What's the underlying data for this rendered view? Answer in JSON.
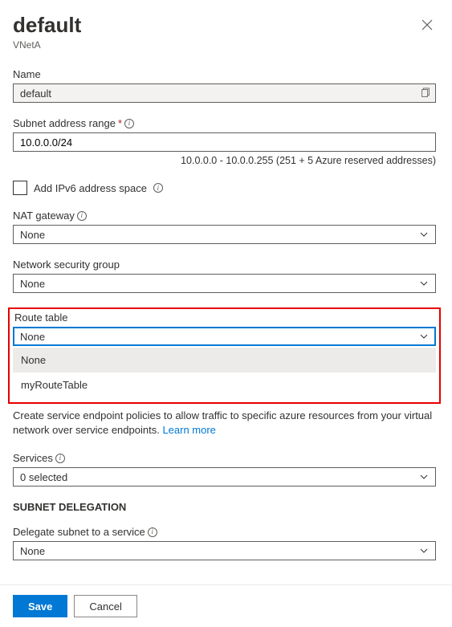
{
  "header": {
    "title": "default",
    "subtitle": "VNetA"
  },
  "name": {
    "label": "Name",
    "value": "default"
  },
  "addressRange": {
    "label": "Subnet address range",
    "value": "10.0.0.0/24",
    "help": "10.0.0.0 - 10.0.0.255 (251 + 5 Azure reserved addresses)"
  },
  "ipv6": {
    "label": "Add IPv6 address space"
  },
  "natGateway": {
    "label": "NAT gateway",
    "value": "None"
  },
  "nsg": {
    "label": "Network security group",
    "value": "None"
  },
  "routeTable": {
    "label": "Route table",
    "value": "None",
    "options": [
      "None",
      "myRouteTable"
    ]
  },
  "endpointDescription": "Create service endpoint policies to allow traffic to specific azure resources from your virtual network over service endpoints. ",
  "learnMore": "Learn more",
  "services": {
    "label": "Services",
    "value": "0 selected"
  },
  "delegation": {
    "sectionHeader": "SUBNET DELEGATION",
    "label": "Delegate subnet to a service",
    "value": "None"
  },
  "footer": {
    "save": "Save",
    "cancel": "Cancel"
  }
}
